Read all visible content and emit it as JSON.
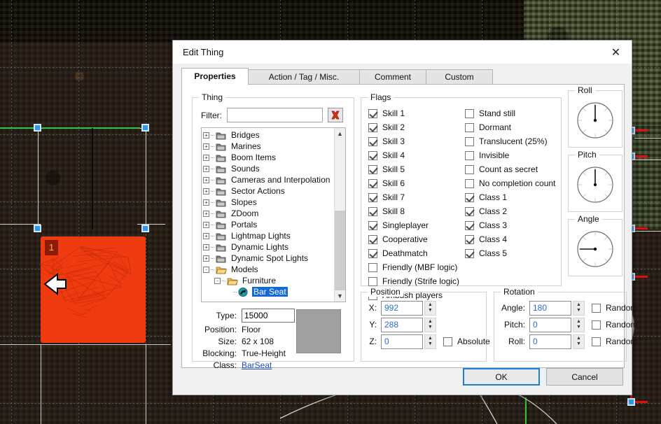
{
  "dialog": {
    "title": "Edit Thing",
    "close_icon": "close-icon",
    "tabs": [
      {
        "label": "Properties",
        "active": true
      },
      {
        "label": "Action / Tag / Misc.",
        "active": false
      },
      {
        "label": "Comment",
        "active": false
      },
      {
        "label": "Custom",
        "active": false
      }
    ],
    "footer": {
      "ok": "OK",
      "cancel": "Cancel"
    }
  },
  "thing_group": {
    "legend": "Thing",
    "filter_label": "Filter:",
    "filter_value": "",
    "filter_placeholder": "",
    "clear_icon": "red-x-clear-icon",
    "tree": [
      {
        "label": "Bridges",
        "depth": 0,
        "expander": "+",
        "icon": "folder-closed-icon",
        "selected": false
      },
      {
        "label": "Marines",
        "depth": 0,
        "expander": "+",
        "icon": "folder-closed-icon",
        "selected": false
      },
      {
        "label": "Boom Items",
        "depth": 0,
        "expander": "+",
        "icon": "folder-closed-icon",
        "selected": false
      },
      {
        "label": "Sounds",
        "depth": 0,
        "expander": "+",
        "icon": "folder-closed-icon",
        "selected": false
      },
      {
        "label": "Cameras and Interpolation",
        "depth": 0,
        "expander": "+",
        "icon": "folder-closed-icon",
        "selected": false
      },
      {
        "label": "Sector Actions",
        "depth": 0,
        "expander": "+",
        "icon": "folder-closed-icon",
        "selected": false
      },
      {
        "label": "Slopes",
        "depth": 0,
        "expander": "+",
        "icon": "folder-closed-icon",
        "selected": false
      },
      {
        "label": "ZDoom",
        "depth": 0,
        "expander": "+",
        "icon": "folder-closed-icon",
        "selected": false
      },
      {
        "label": "Portals",
        "depth": 0,
        "expander": "+",
        "icon": "folder-closed-icon",
        "selected": false
      },
      {
        "label": "Lightmap Lights",
        "depth": 0,
        "expander": "+",
        "icon": "folder-closed-icon",
        "selected": false
      },
      {
        "label": "Dynamic Lights",
        "depth": 0,
        "expander": "+",
        "icon": "folder-closed-icon",
        "selected": false
      },
      {
        "label": "Dynamic Spot Lights",
        "depth": 0,
        "expander": "+",
        "icon": "folder-closed-icon",
        "selected": false
      },
      {
        "label": "Models",
        "depth": 0,
        "expander": "-",
        "icon": "folder-open-icon",
        "selected": false
      },
      {
        "label": "Furniture",
        "depth": 1,
        "expander": "-",
        "icon": "folder-open-icon",
        "selected": false
      },
      {
        "label": "Bar Seat",
        "depth": 2,
        "expander": "",
        "icon": "thing-sprite-icon",
        "selected": true
      }
    ],
    "scrollbar": {
      "up_icon": "chevron-up-icon",
      "down_icon": "chevron-down-icon"
    },
    "info": {
      "type_label": "Type:",
      "type_value": "15000",
      "position_label": "Position:",
      "position_value": "Floor",
      "size_label": "Size:",
      "size_value": "62 x 108",
      "blocking_label": "Blocking:",
      "blocking_value": "True-Height",
      "class_label": "Class:",
      "class_value": "BarSeat"
    }
  },
  "flags_group": {
    "legend": "Flags",
    "column1": [
      {
        "label": "Skill 1",
        "checked": true
      },
      {
        "label": "Skill 2",
        "checked": true
      },
      {
        "label": "Skill 3",
        "checked": true
      },
      {
        "label": "Skill 4",
        "checked": true
      },
      {
        "label": "Skill 5",
        "checked": true
      },
      {
        "label": "Skill 6",
        "checked": true
      },
      {
        "label": "Skill 7",
        "checked": true
      },
      {
        "label": "Skill 8",
        "checked": true
      },
      {
        "label": "Singleplayer",
        "checked": true
      },
      {
        "label": "Cooperative",
        "checked": true
      },
      {
        "label": "Deathmatch",
        "checked": true
      },
      {
        "label": "Friendly (MBF logic)",
        "checked": false
      },
      {
        "label": "Friendly (Strife logic)",
        "checked": false
      },
      {
        "label": "Ambush players",
        "checked": false
      }
    ],
    "column2": [
      {
        "label": "Stand still",
        "checked": false
      },
      {
        "label": "Dormant",
        "checked": false
      },
      {
        "label": "Translucent (25%)",
        "checked": false
      },
      {
        "label": "Invisible",
        "checked": false
      },
      {
        "label": "Count as secret",
        "checked": false
      },
      {
        "label": "No completion count",
        "checked": false
      },
      {
        "label": "Class 1",
        "checked": true
      },
      {
        "label": "Class 2",
        "checked": true
      },
      {
        "label": "Class 3",
        "checked": true
      },
      {
        "label": "Class 4",
        "checked": true
      },
      {
        "label": "Class 5",
        "checked": true
      }
    ]
  },
  "position_group": {
    "legend": "Position",
    "fields": [
      {
        "label": "X:",
        "value": "992"
      },
      {
        "label": "Y:",
        "value": "288"
      },
      {
        "label": "Z:",
        "value": "0"
      }
    ],
    "absolute_label": "Absolute",
    "absolute_checked": false
  },
  "rotation_group": {
    "legend": "Rotation",
    "fields": [
      {
        "label": "Angle:",
        "value": "180",
        "random_label": "Random",
        "random_checked": false
      },
      {
        "label": "Pitch:",
        "value": "0",
        "random_label": "Random",
        "random_checked": false
      },
      {
        "label": "Roll:",
        "value": "0",
        "random_label": "Random",
        "random_checked": false
      }
    ]
  },
  "dials": [
    {
      "legend": "Roll",
      "value": 0,
      "name": "roll-dial"
    },
    {
      "legend": "Pitch",
      "value": 0,
      "name": "pitch-dial"
    },
    {
      "legend": "Angle",
      "value": 180,
      "name": "angle-dial"
    }
  ],
  "map": {
    "selected_sector_label": "1",
    "accent_selected": "#f03a10",
    "vertex_color": "#3399e8",
    "linedef_color": "#cfcfc8",
    "red_linedef_color": "#e01010",
    "green_linedef_color": "#35c04a"
  }
}
